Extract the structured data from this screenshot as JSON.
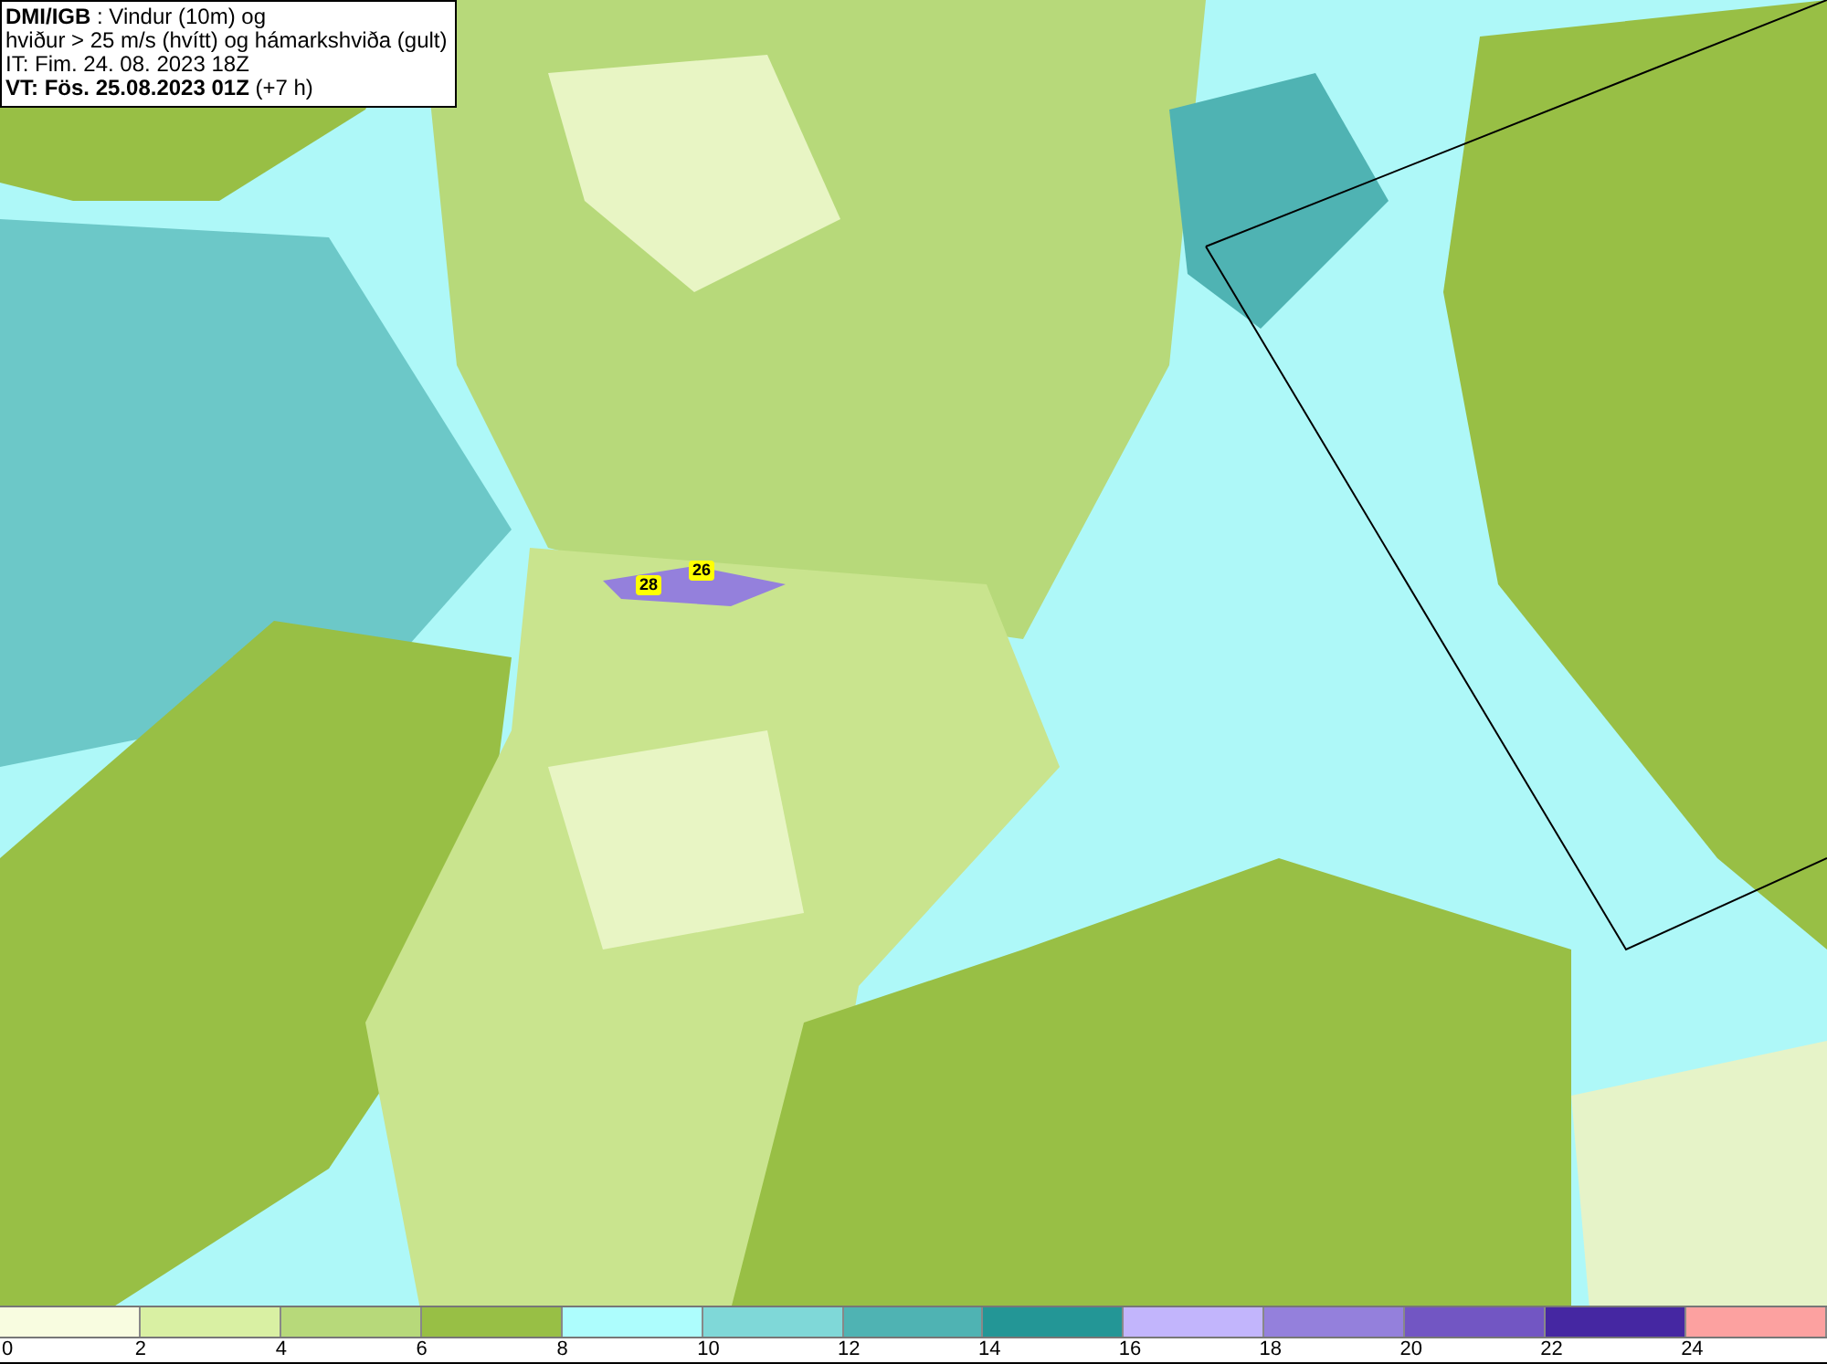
{
  "title_box": {
    "lines": [
      "**DMI/IGB** : Vindur (10m) og",
      "hviður > 25 m/s (hvítt) og hámarkshviða (gult)",
      "IT: Fim. 24. 08. 2023 18Z",
      "**VT: Fös. 25.08.2023 01Z** (+7 h)"
    ]
  },
  "map": {
    "gust_labels": [
      {
        "text": "28"
      },
      {
        "text": "26"
      }
    ]
  },
  "legend": {
    "segments": [
      {
        "color": "#f8fce0"
      },
      {
        "color": "#d9f0a3"
      },
      {
        "color": "#b7d97a"
      },
      {
        "color": "#98bf45"
      },
      {
        "color": "#adfdfd"
      },
      {
        "color": "#7fd8d8"
      },
      {
        "color": "#4fb3b3"
      },
      {
        "color": "#239696"
      },
      {
        "color": "#c2b5fc"
      },
      {
        "color": "#9480dc"
      },
      {
        "color": "#7256c3"
      },
      {
        "color": "#4527a2"
      },
      {
        "color": "#fca1a0"
      }
    ],
    "ticks": [
      "0",
      "2",
      "4",
      "6",
      "8",
      "10",
      "12",
      "14",
      "16",
      "18",
      "20",
      "22",
      "24"
    ]
  }
}
